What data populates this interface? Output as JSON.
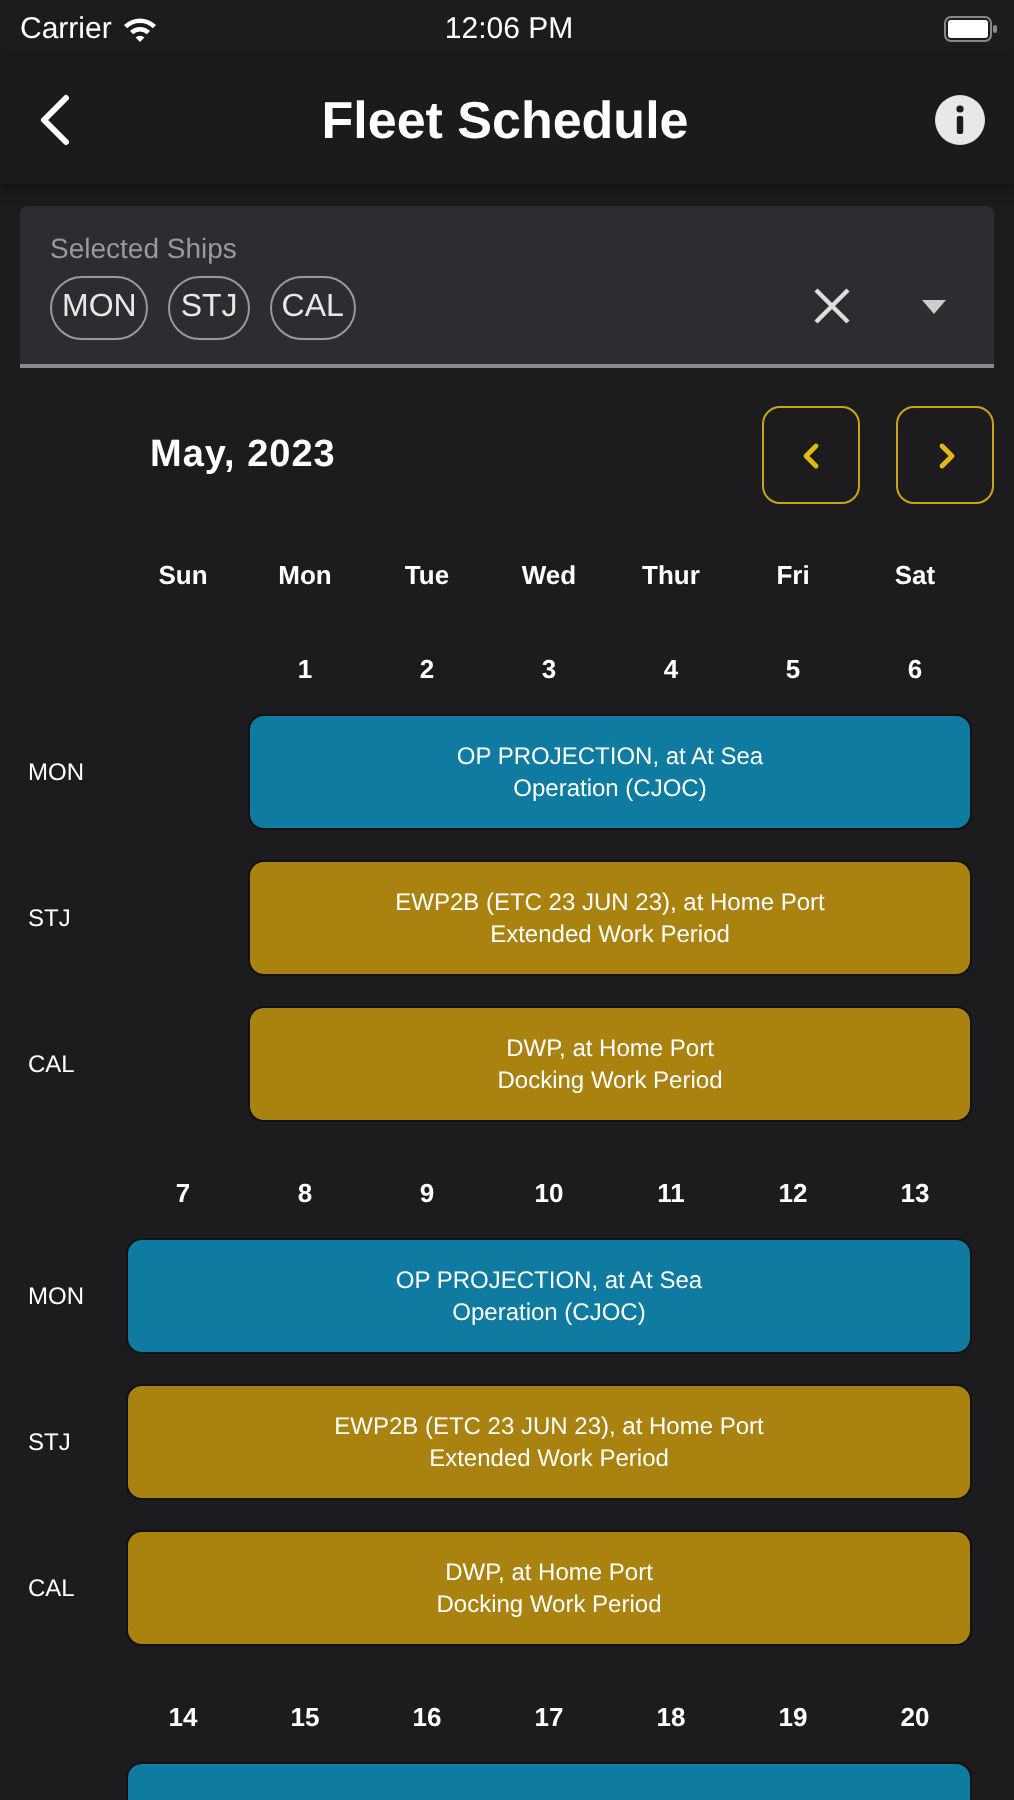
{
  "status_bar": {
    "carrier": "Carrier",
    "time": "12:06 PM"
  },
  "nav": {
    "title": "Fleet Schedule"
  },
  "ship_picker": {
    "label": "Selected Ships",
    "chips": [
      "MON",
      "STJ",
      "CAL"
    ]
  },
  "calendar": {
    "month": "May, 2023",
    "weekdays": [
      "Sun",
      "Mon",
      "Tue",
      "Wed",
      "Thur",
      "Fri",
      "Sat"
    ],
    "weeks": [
      {
        "days": [
          "1",
          "2",
          "3",
          "4",
          "5",
          "6"
        ],
        "rows": [
          {
            "ship": "MON",
            "kind": "operation",
            "lines": [
              "OP PROJECTION, at At Sea",
              "Operation (CJOC)"
            ]
          },
          {
            "ship": "STJ",
            "kind": "work",
            "lines": [
              "EWP2B (ETC 23 JUN 23), at Home Port",
              "Extended Work Period"
            ]
          },
          {
            "ship": "CAL",
            "kind": "work",
            "lines": [
              "DWP, at Home Port",
              "Docking Work Period"
            ]
          }
        ]
      },
      {
        "days": [
          "7",
          "8",
          "9",
          "10",
          "11",
          "12",
          "13"
        ],
        "rows": [
          {
            "ship": "MON",
            "kind": "operation",
            "lines": [
              "OP PROJECTION, at At Sea",
              "Operation (CJOC)"
            ]
          },
          {
            "ship": "STJ",
            "kind": "work",
            "lines": [
              "EWP2B (ETC 23 JUN 23), at Home Port",
              "Extended Work Period"
            ]
          },
          {
            "ship": "CAL",
            "kind": "work",
            "lines": [
              "DWP, at Home Port",
              "Docking Work Period"
            ]
          }
        ]
      },
      {
        "days": [
          "14",
          "15",
          "16",
          "17",
          "18",
          "19",
          "20"
        ],
        "rows": [
          {
            "kind": "operation"
          }
        ]
      }
    ]
  }
}
